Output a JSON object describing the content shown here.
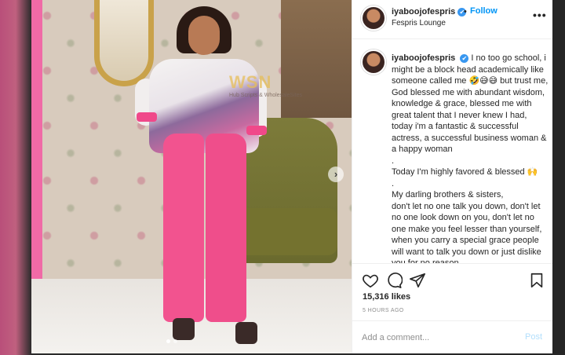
{
  "post": {
    "username": "iyaboojofespris",
    "verified_mark": "✔",
    "separator": "•",
    "follow_label": "Follow",
    "location": "Fespris Lounge",
    "more_label": "•••"
  },
  "photo": {
    "watermark": "WSN",
    "watermark_sub": "Hub Scripts & WholesaleSites",
    "next_label": "›"
  },
  "caption": {
    "username": "iyaboojofespris",
    "line1": "I no too go school, i might be a block head academically like someone called me 🤣😅😅 but trust me, God blessed me with abundant wisdom, knowledge & grace, blessed me with great talent that I never knew I had, today i'm a fantastic & successful actress, a successful business woman & a happy woman",
    "dot1": ".",
    "line2": "Today I'm highly favored & blessed 🙌",
    "dot2": ".",
    "line3": "My darling brothers & sisters,",
    "line4": "don't let no one talk you down, don't let no one look down on you, don't let no one make you feel lesser than yourself, when you carry a special grace people will want to talk you down or just dislike you for no reason,"
  },
  "actions": {
    "likes": "15,316 likes",
    "time_ago": "5 HOURS AGO"
  },
  "comment": {
    "placeholder": "Add a comment...",
    "post_label": "Post"
  },
  "colors": {
    "accent": "#0095f6",
    "verified": "#3897f0",
    "pants": "#f2538f"
  }
}
